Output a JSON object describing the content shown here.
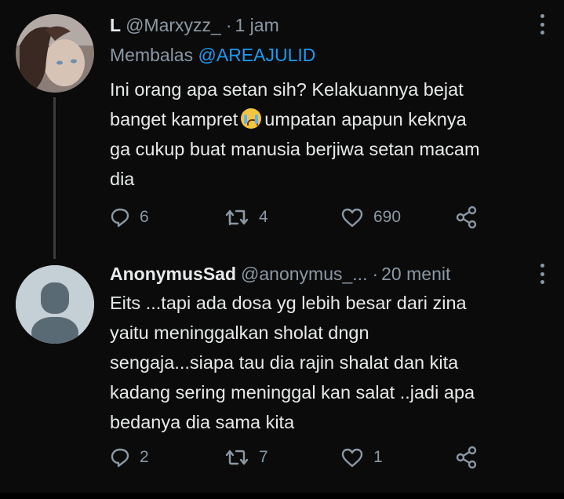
{
  "tweets": [
    {
      "name": "L",
      "handle": "@Marxyzz_",
      "separator": "·",
      "time": "1 jam",
      "replying_prefix": "Membalas",
      "replying_to": "@AREAJULID",
      "text_lines": [
        "Ini orang apa setan sih? Kelakuannya bejat",
        "banget kampret",
        "umpatan apapun keknya",
        "ga cukup buat manusia berjiwa setan macam",
        "dia"
      ],
      "emoji": "crying-face-emoji",
      "reply_count": "6",
      "retweet_count": "4",
      "like_count": "690",
      "avatar": "photo-avatar"
    },
    {
      "name": "AnonymusSad",
      "handle": "@anonymus_...",
      "separator": "·",
      "time": "20 menit",
      "text_lines": [
        "Eits ...tapi ada dosa yg lebih besar dari zina",
        "yaitu meninggalkan sholat dngn",
        "sengaja...siapa tau dia rajin shalat dan kita",
        "kadang sering meninggal kan salat ..jadi apa",
        "bedanya dia sama kita"
      ],
      "reply_count": "2",
      "retweet_count": "7",
      "like_count": "1",
      "avatar": "default-avatar"
    }
  ],
  "icons": {
    "reply": "reply-icon",
    "retweet": "retweet-icon",
    "like": "heart-icon",
    "share": "share-icon",
    "more": "more-options-icon"
  },
  "colors": {
    "background": "#0b0b0b",
    "text_primary": "#e7e9ea",
    "text_secondary": "#8b98a5",
    "mention": "#1d9bf0",
    "default_avatar": "#c4cfd6"
  }
}
